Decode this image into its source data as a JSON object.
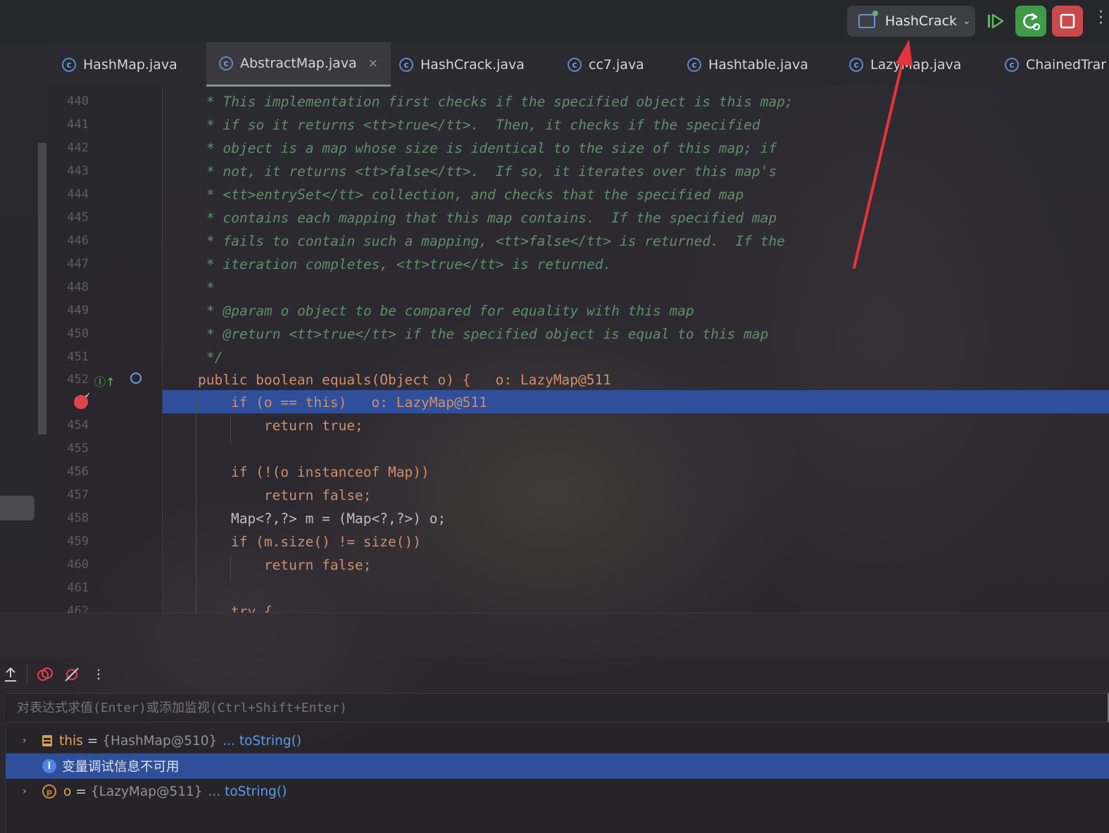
{
  "toolbar": {
    "run_config": "HashCrack",
    "colors": {
      "rerun_bg": "#3f9a4a",
      "stop_bg": "#c94a4a",
      "resume": "#5fb85d"
    }
  },
  "tabs": [
    {
      "label": "HashMap.java",
      "active": false
    },
    {
      "label": "AbstractMap.java",
      "active": true
    },
    {
      "label": "HashCrack.java",
      "active": false
    },
    {
      "label": "cc7.java",
      "active": false
    },
    {
      "label": "Hashtable.java",
      "active": false
    },
    {
      "label": "LazyMap.java",
      "active": false
    },
    {
      "label": "ChainedTrar",
      "active": false
    }
  ],
  "editor": {
    "lines": [
      {
        "num": "440",
        "text": "* This implementation first checks if the specified object is this map;"
      },
      {
        "num": "441",
        "text": "* if so it returns <tt>true</tt>.  Then, it checks if the specified"
      },
      {
        "num": "442",
        "text": "* object is a map whose size is identical to the size of this map; if"
      },
      {
        "num": "443",
        "text": "* not, it returns <tt>false</tt>.  If so, it iterates over this map's"
      },
      {
        "num": "444",
        "text": "* <tt>entrySet</tt> collection, and checks that the specified map"
      },
      {
        "num": "445",
        "text": "* contains each mapping that this map contains.  If the specified map"
      },
      {
        "num": "446",
        "text": "* fails to contain such a mapping, <tt>false</tt> is returned.  If the"
      },
      {
        "num": "447",
        "text": "* iteration completes, <tt>true</tt> is returned."
      },
      {
        "num": "448",
        "text": "*"
      },
      {
        "num": "449",
        "text": "* @param o object to be compared for equality with this map"
      },
      {
        "num": "450",
        "text": "* @return <tt>true</tt> if the specified object is equal to this map"
      },
      {
        "num": "451",
        "text": "*/"
      },
      {
        "num": "452",
        "text": "public boolean equals(Object o) {   o: LazyMap@511"
      },
      {
        "num": "",
        "text": "    if (o == this)   o: LazyMap@511"
      },
      {
        "num": "454",
        "text": "        return true;"
      },
      {
        "num": "455",
        "text": ""
      },
      {
        "num": "456",
        "text": "    if (!(o instanceof Map))"
      },
      {
        "num": "457",
        "text": "        return false;"
      },
      {
        "num": "458",
        "text": "    Map<?,?> m = (Map<?,?>) o;"
      },
      {
        "num": "459",
        "text": "    if (m.size() != size())"
      },
      {
        "num": "460",
        "text": "        return false;"
      },
      {
        "num": "461",
        "text": ""
      },
      {
        "num": "462",
        "text": "    try {"
      }
    ]
  },
  "debugger": {
    "eval_placeholder": "对表达式求值(Enter)或添加监视(Ctrl+Shift+Enter)",
    "variables": [
      {
        "name": "this",
        "value": "{HashMap@510}",
        "link": "... toString()"
      },
      {
        "info": "变量调试信息不可用"
      },
      {
        "name": "o",
        "value": "{LazyMap@511}",
        "link": "... toString()"
      }
    ]
  }
}
